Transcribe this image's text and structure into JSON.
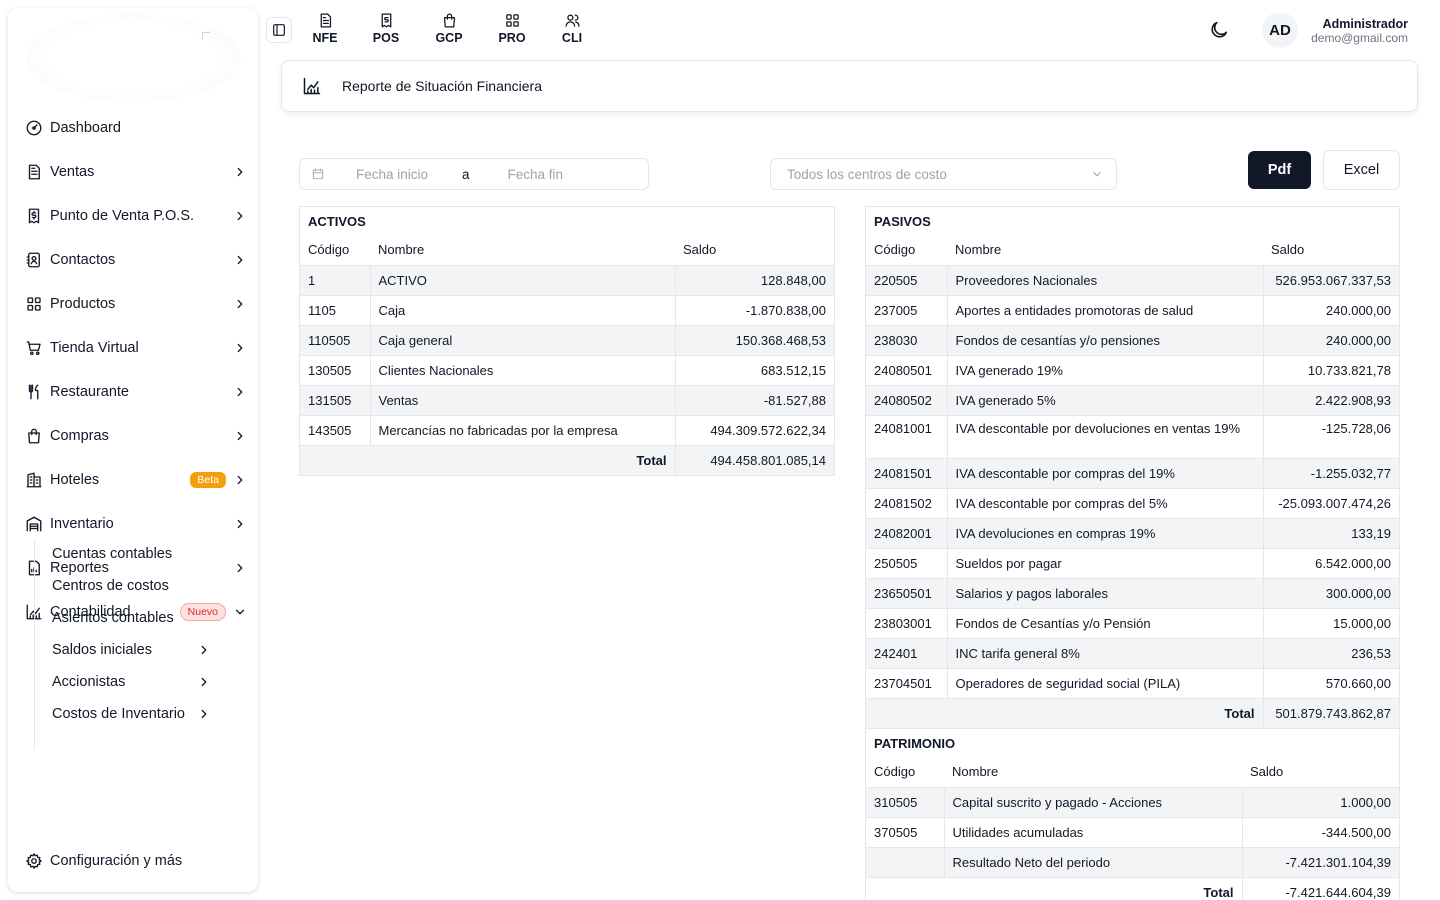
{
  "sidebar": {
    "items": [
      {
        "label": "Dashboard",
        "icon": "dashboard-icon"
      },
      {
        "label": "Ventas",
        "icon": "invoice-icon"
      },
      {
        "label": "Punto de Venta P.O.S.",
        "icon": "receipt-dollar-icon"
      },
      {
        "label": "Contactos",
        "icon": "contacts-icon"
      },
      {
        "label": "Productos",
        "icon": "grid-icon"
      },
      {
        "label": "Tienda Virtual",
        "icon": "cart-icon"
      },
      {
        "label": "Restaurante",
        "icon": "utensils-icon"
      },
      {
        "label": "Compras",
        "icon": "shopping-bag-icon"
      },
      {
        "label": "Hoteles",
        "icon": "hotel-icon",
        "badge": "Beta"
      },
      {
        "label": "Inventario",
        "icon": "warehouse-icon"
      },
      {
        "label": "Reportes",
        "icon": "report-icon"
      },
      {
        "label": "Contabilidad",
        "icon": "chart-icon",
        "badge": "Nuevo"
      }
    ],
    "sub_items": [
      {
        "label": "Cuentas contables"
      },
      {
        "label": "Centros de costos"
      },
      {
        "label": "Asientos contables"
      },
      {
        "label": "Saldos iniciales"
      },
      {
        "label": "Accionistas"
      },
      {
        "label": "Costos de Inventario"
      }
    ],
    "settings_label": "Configuración y más"
  },
  "topbar": {
    "quick_links": [
      "NFE",
      "POS",
      "GCP",
      "PRO",
      "CLI"
    ],
    "user_initials": "AD",
    "user_name": "Administrador",
    "user_email": "demo@gmail.com"
  },
  "report": {
    "title": "Reporte de Situación Financiera"
  },
  "filters": {
    "date_start_placeholder": "Fecha inicio",
    "date_separator": "a",
    "date_end_placeholder": "Fecha fin",
    "cost_center_placeholder": "Todos los centros de costo",
    "pdf_label": "Pdf",
    "excel_label": "Excel"
  },
  "activos": {
    "title": "ACTIVOS",
    "headers": [
      "Código",
      "Nombre",
      "Saldo"
    ],
    "rows": [
      {
        "code": "1",
        "name": "ACTIVO",
        "balance": "128.848,00"
      },
      {
        "code": "1105",
        "name": "Caja",
        "balance": "-1.870.838,00"
      },
      {
        "code": "110505",
        "name": "Caja general",
        "balance": "150.368.468,53"
      },
      {
        "code": "130505",
        "name": "Clientes Nacionales",
        "balance": "683.512,15"
      },
      {
        "code": "131505",
        "name": "Ventas",
        "balance": "-81.527,88"
      },
      {
        "code": "143505",
        "name": "Mercancías no fabricadas por la empresa",
        "balance": "494.309.572.622,34"
      }
    ],
    "total_label": "Total",
    "total": "494.458.801.085,14"
  },
  "pasivos": {
    "title": "PASIVOS",
    "headers": [
      "Código",
      "Nombre",
      "Saldo"
    ],
    "rows": [
      {
        "code": "220505",
        "name": "Proveedores Nacionales",
        "balance": "526.953.067.337,53"
      },
      {
        "code": "237005",
        "name": "Aportes a entidades promotoras de salud",
        "balance": "240.000,00"
      },
      {
        "code": "238030",
        "name": "Fondos de cesantías y/o pensiones",
        "balance": "240.000,00"
      },
      {
        "code": "24080501",
        "name": "IVA generado 19%",
        "balance": "10.733.821,78"
      },
      {
        "code": "24080502",
        "name": "IVA generado 5%",
        "balance": "2.422.908,93"
      },
      {
        "code": "24081001",
        "name": "IVA descontable por devoluciones en ventas 19%",
        "balance": "-125.728,06"
      },
      {
        "code": "24081501",
        "name": "IVA descontable por compras del 19%",
        "balance": "-1.255.032,77"
      },
      {
        "code": "24081502",
        "name": "IVA descontable por compras del 5%",
        "balance": "-25.093.007.474,26"
      },
      {
        "code": "24082001",
        "name": "IVA devoluciones en compras 19%",
        "balance": "133,19"
      },
      {
        "code": "250505",
        "name": "Sueldos por pagar",
        "balance": "6.542.000,00"
      },
      {
        "code": "23650501",
        "name": "Salarios y pagos laborales",
        "balance": "300.000,00"
      },
      {
        "code": "23803001",
        "name": "Fondos de Cesantías y/o Pensión",
        "balance": "15.000,00"
      },
      {
        "code": "242401",
        "name": "INC tarifa general 8%",
        "balance": "236,53"
      },
      {
        "code": "23704501",
        "name": "Operadores de seguridad social (PILA)",
        "balance": "570.660,00"
      }
    ],
    "total_label": "Total",
    "total": "501.879.743.862,87"
  },
  "patrimonio": {
    "title": "PATRIMONIO",
    "headers": [
      "Código",
      "Nombre",
      "Saldo"
    ],
    "rows": [
      {
        "code": "310505",
        "name": "Capital suscrito y pagado - Acciones",
        "balance": "1.000,00"
      },
      {
        "code": "370505",
        "name": "Utilidades acumuladas",
        "balance": "-344.500,00"
      },
      {
        "code": "",
        "name": "Resultado Neto del periodo",
        "balance": "-7.421.301.104,39"
      }
    ],
    "total_label": "Total",
    "total": "-7.421.644.604,39"
  }
}
